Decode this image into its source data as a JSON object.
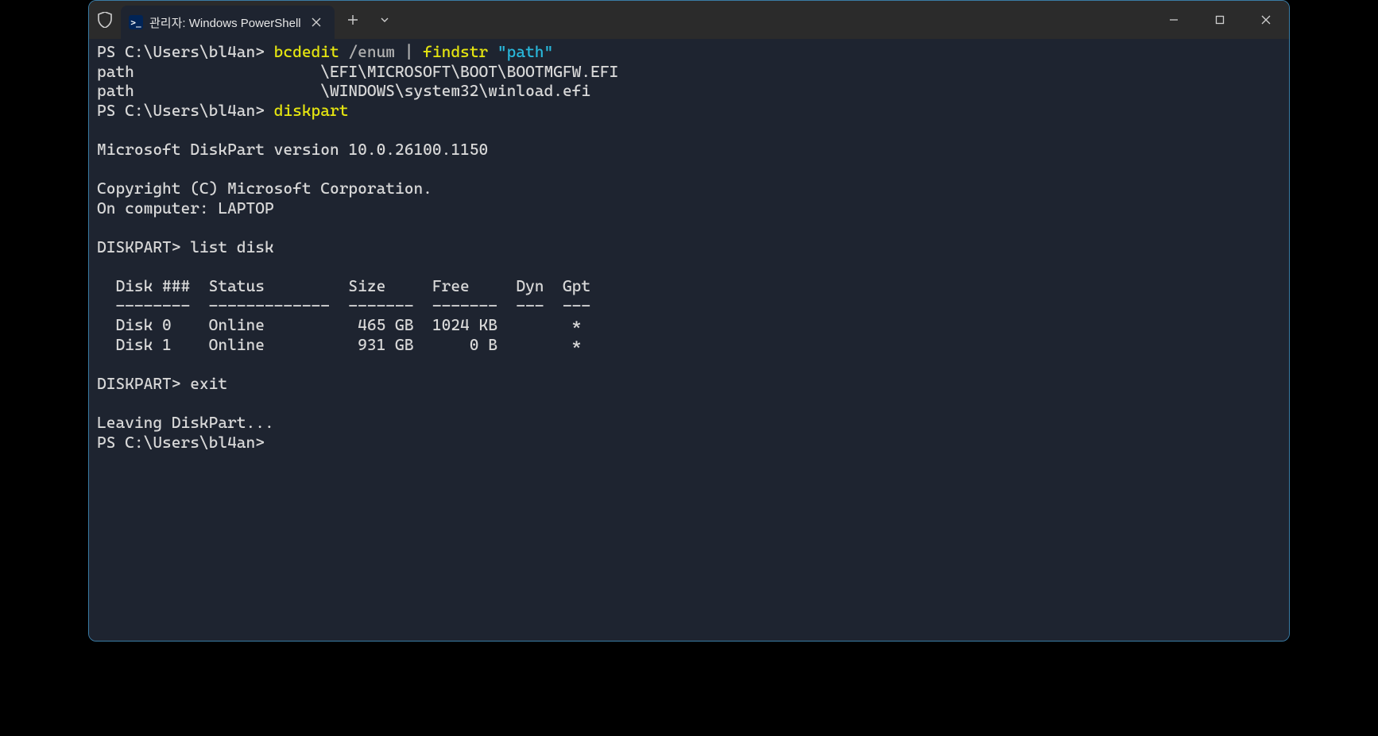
{
  "window": {
    "tab_title": "관리자: Windows PowerShell"
  },
  "term": {
    "prompt1": "PS C:\\Users\\bl4an> ",
    "cmd1_a": "bcdedit",
    "cmd1_b": " /enum ",
    "cmd1_pipe": "|",
    "cmd1_c": " findstr ",
    "cmd1_str": "\"path\"",
    "out1_l1": "path                    \\EFI\\MICROSOFT\\BOOT\\BOOTMGFW.EFI",
    "out1_l2": "path                    \\WINDOWS\\system32\\winload.efi",
    "prompt2": "PS C:\\Users\\bl4an> ",
    "cmd2": "diskpart",
    "blank": "",
    "dp_ver": "Microsoft DiskPart version 10.0.26100.1150",
    "dp_copy": "Copyright (C) Microsoft Corporation.",
    "dp_comp": "On computer: LAPTOP",
    "dp_prompt1": "DISKPART> ",
    "dp_cmd1": "list disk",
    "tbl_hdr": "  Disk ###  Status         Size     Free     Dyn  Gpt",
    "tbl_sep": "  --------  -------------  -------  -------  ---  ---",
    "tbl_r0": "  Disk 0    Online          465 GB  1024 KB        *",
    "tbl_r1": "  Disk 1    Online          931 GB      0 B        *",
    "dp_prompt2": "DISKPART> ",
    "dp_cmd2": "exit",
    "dp_leave": "Leaving DiskPart...",
    "prompt3": "PS C:\\Users\\bl4an>"
  }
}
